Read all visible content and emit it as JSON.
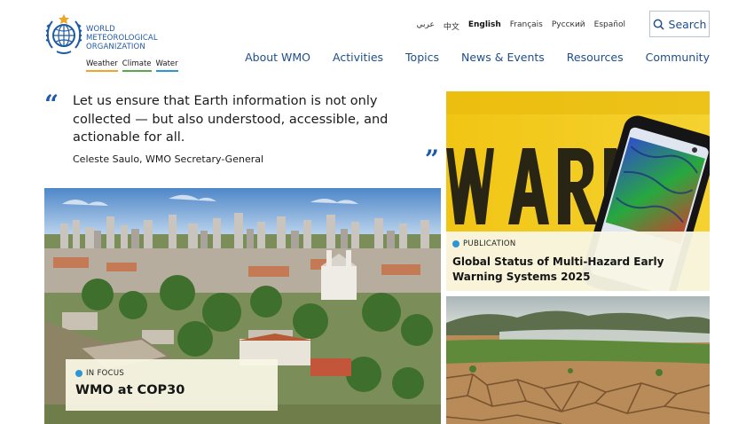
{
  "logo": {
    "name_lines": [
      "WORLD",
      "METEOROLOGICAL",
      "ORGANIZATION"
    ],
    "tagline": [
      "Weather",
      "Climate",
      "Water"
    ],
    "tagline_colors": [
      "#f0a526",
      "#5aa84b",
      "#2e96d4"
    ]
  },
  "languages": [
    "عربي",
    "中文",
    "English",
    "Français",
    "Русский",
    "Español"
  ],
  "active_language": "English",
  "search": {
    "label": "Search"
  },
  "nav": [
    "About WMO",
    "Activities",
    "Topics",
    "News & Events",
    "Resources",
    "Community"
  ],
  "quote": {
    "text": "Let us ensure that Earth information is not only collected — but also understood, accessible, and actionable for all.",
    "author": "Celeste Saulo, WMO Secretary-General",
    "open_mark": "“",
    "close_mark": "”"
  },
  "cards": {
    "cop": {
      "kicker": "IN FOCUS",
      "headline": "WMO at COP30"
    },
    "publication": {
      "kicker": "PUBLICATION",
      "headline": "Global Status of Multi-Hazard Early Warning Systems 2025"
    },
    "drought": {}
  },
  "colors": {
    "brand_blue": "#1f5aa6",
    "nav_blue": "#1f4e8c",
    "kicker_dot": "#2e96d4"
  },
  "icons": {
    "search": "search-icon",
    "emblem": "wmo-emblem-icon"
  }
}
